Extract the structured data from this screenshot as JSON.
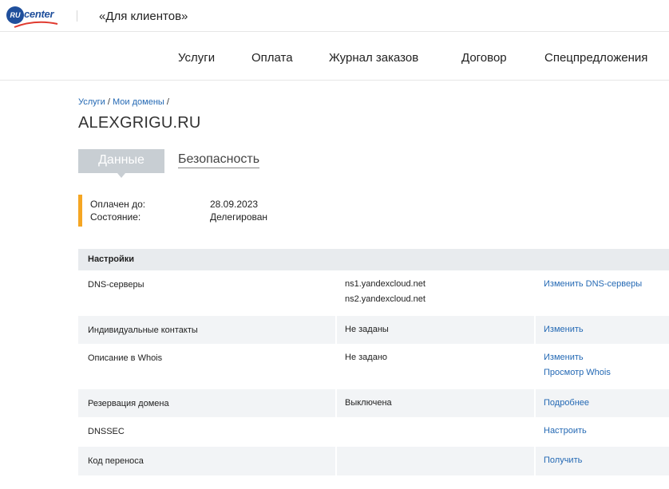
{
  "logo": {
    "badge": "RU",
    "word": "center"
  },
  "header": {
    "client_title": "«Для клиентов»"
  },
  "nav": {
    "items": [
      {
        "label": "Услуги"
      },
      {
        "label": "Оплата"
      },
      {
        "label": "Журнал заказов"
      },
      {
        "label": "Договор"
      },
      {
        "label": "Спецпредложения"
      }
    ]
  },
  "breadcrumb": {
    "items": [
      {
        "label": "Услуги"
      },
      {
        "label": "Мои домены"
      }
    ],
    "separator": "/"
  },
  "page": {
    "title": "ALEXGRIGU.RU"
  },
  "tabs": [
    {
      "label": "Данные"
    },
    {
      "label": "Безопасность"
    }
  ],
  "status": {
    "rows": [
      {
        "label": "Оплачен до:",
        "value": "28.09.2023"
      },
      {
        "label": "Состояние:",
        "value": "Делегирован"
      }
    ],
    "accent_color": "#f5a623"
  },
  "settings": {
    "title": "Настройки",
    "rows": [
      {
        "name": "DNS-серверы",
        "values": [
          "ns1.yandexcloud.net",
          "ns2.yandexcloud.net"
        ],
        "actions": [
          "Изменить DNS-серверы"
        ]
      },
      {
        "name": "Индивидуальные контакты",
        "values": [
          "Не заданы"
        ],
        "actions": [
          "Изменить"
        ]
      },
      {
        "name": "Описание в Whois",
        "values": [
          "Не задано"
        ],
        "actions": [
          "Изменить",
          "Просмотр Whois"
        ]
      },
      {
        "name": "Резервация домена",
        "values": [
          "Выключена"
        ],
        "actions": [
          "Подробнее"
        ]
      },
      {
        "name": "DNSSEC",
        "values": [],
        "actions": [
          "Настроить"
        ]
      },
      {
        "name": "Код переноса",
        "values": [],
        "actions": [
          "Получить"
        ]
      }
    ]
  },
  "colors": {
    "link": "#2469b4",
    "brand": "#1f4f9c",
    "tab_active_bg": "#c8ced3",
    "header_bg": "#e8ebee",
    "row_shade": "#f2f4f6"
  }
}
